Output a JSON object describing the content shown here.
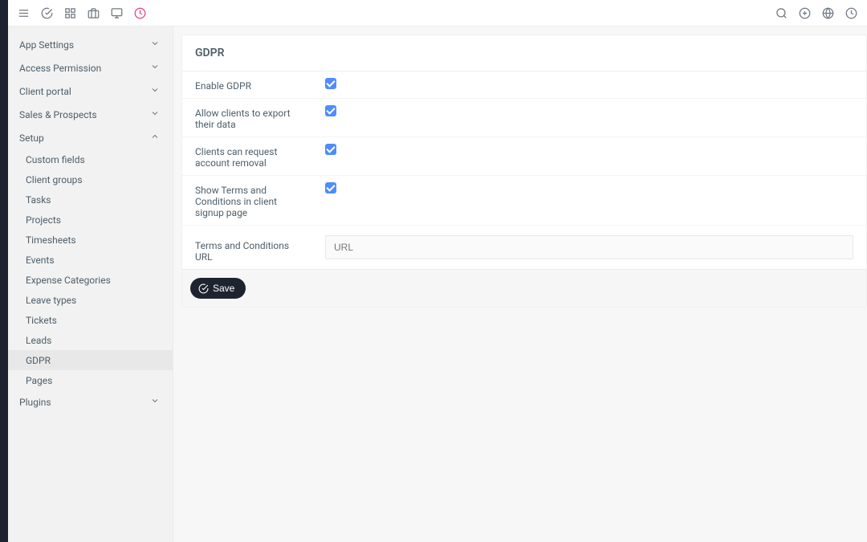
{
  "topbar": {
    "left": [
      {
        "name": "menu-icon"
      },
      {
        "name": "check-circle-icon"
      },
      {
        "name": "grid-icon"
      },
      {
        "name": "briefcase-icon"
      },
      {
        "name": "monitor-icon"
      },
      {
        "name": "clock-alert-icon"
      }
    ],
    "right": [
      {
        "name": "search-icon"
      },
      {
        "name": "plus-circle-icon"
      },
      {
        "name": "globe-icon"
      },
      {
        "name": "clock-icon"
      }
    ]
  },
  "sidebar": {
    "sections": [
      {
        "label": "App Settings",
        "expanded": false
      },
      {
        "label": "Access Permission",
        "expanded": false
      },
      {
        "label": "Client portal",
        "expanded": false
      },
      {
        "label": "Sales & Prospects",
        "expanded": false
      },
      {
        "label": "Setup",
        "expanded": true,
        "items": [
          {
            "label": "Custom fields"
          },
          {
            "label": "Client groups"
          },
          {
            "label": "Tasks"
          },
          {
            "label": "Projects"
          },
          {
            "label": "Timesheets"
          },
          {
            "label": "Events"
          },
          {
            "label": "Expense Categories"
          },
          {
            "label": "Leave types"
          },
          {
            "label": "Tickets"
          },
          {
            "label": "Leads"
          },
          {
            "label": "GDPR",
            "active": true
          },
          {
            "label": "Pages"
          }
        ]
      },
      {
        "label": "Plugins",
        "expanded": false
      }
    ]
  },
  "page": {
    "title": "GDPR",
    "rows": [
      {
        "label": "Enable GDPR",
        "checked": true
      },
      {
        "label": "Allow clients to export their data",
        "checked": true
      },
      {
        "label": "Clients can request account removal",
        "checked": true
      },
      {
        "label": "Show Terms and Conditions in client signup page",
        "checked": true
      }
    ],
    "url_row": {
      "label": "Terms and Conditions URL",
      "placeholder": "URL",
      "value": ""
    },
    "save_label": "Save"
  }
}
